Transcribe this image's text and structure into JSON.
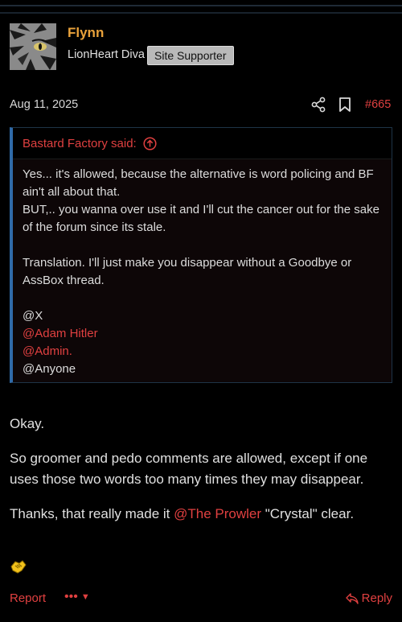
{
  "post": {
    "username": "Flynn",
    "user_title": "LionHeart Diva",
    "banner": "Site Supporter",
    "date": "Aug 11, 2025",
    "post_number": "#665"
  },
  "quote": {
    "author_line": "Bastard Factory said:",
    "lines": [
      "Yes... it's allowed, because the alternative is word policing and BF ain't all about that.",
      "BUT,.. you wanna over use it and I'll cut the cancer out for the sake of the forum since its stale.",
      "Translation. I'll just make you disappear without a Goodbye or AssBox thread.",
      "@X",
      "@Adam Hitler",
      "@Admin.",
      "@Anyone"
    ]
  },
  "body": {
    "p1": "Okay.",
    "p2": "So groomer and pedo comments are allowed, except if one uses those two words too many times they may disappear.",
    "p3_before": "Thanks, that really made it ",
    "p3_mention": "@The Prowler",
    "p3_after": " \"Crystal\" clear."
  },
  "actions": {
    "report": "Report",
    "more": "•••",
    "reply": "Reply"
  },
  "colors": {
    "accent": "#e04040",
    "username": "#e9a23b",
    "quote_border": "#2f6aa8"
  },
  "icons": [
    "share-icon",
    "bookmark-icon",
    "arrow-up-circle-icon",
    "handshake-icon",
    "chevron-down-icon",
    "reply-icon"
  ]
}
